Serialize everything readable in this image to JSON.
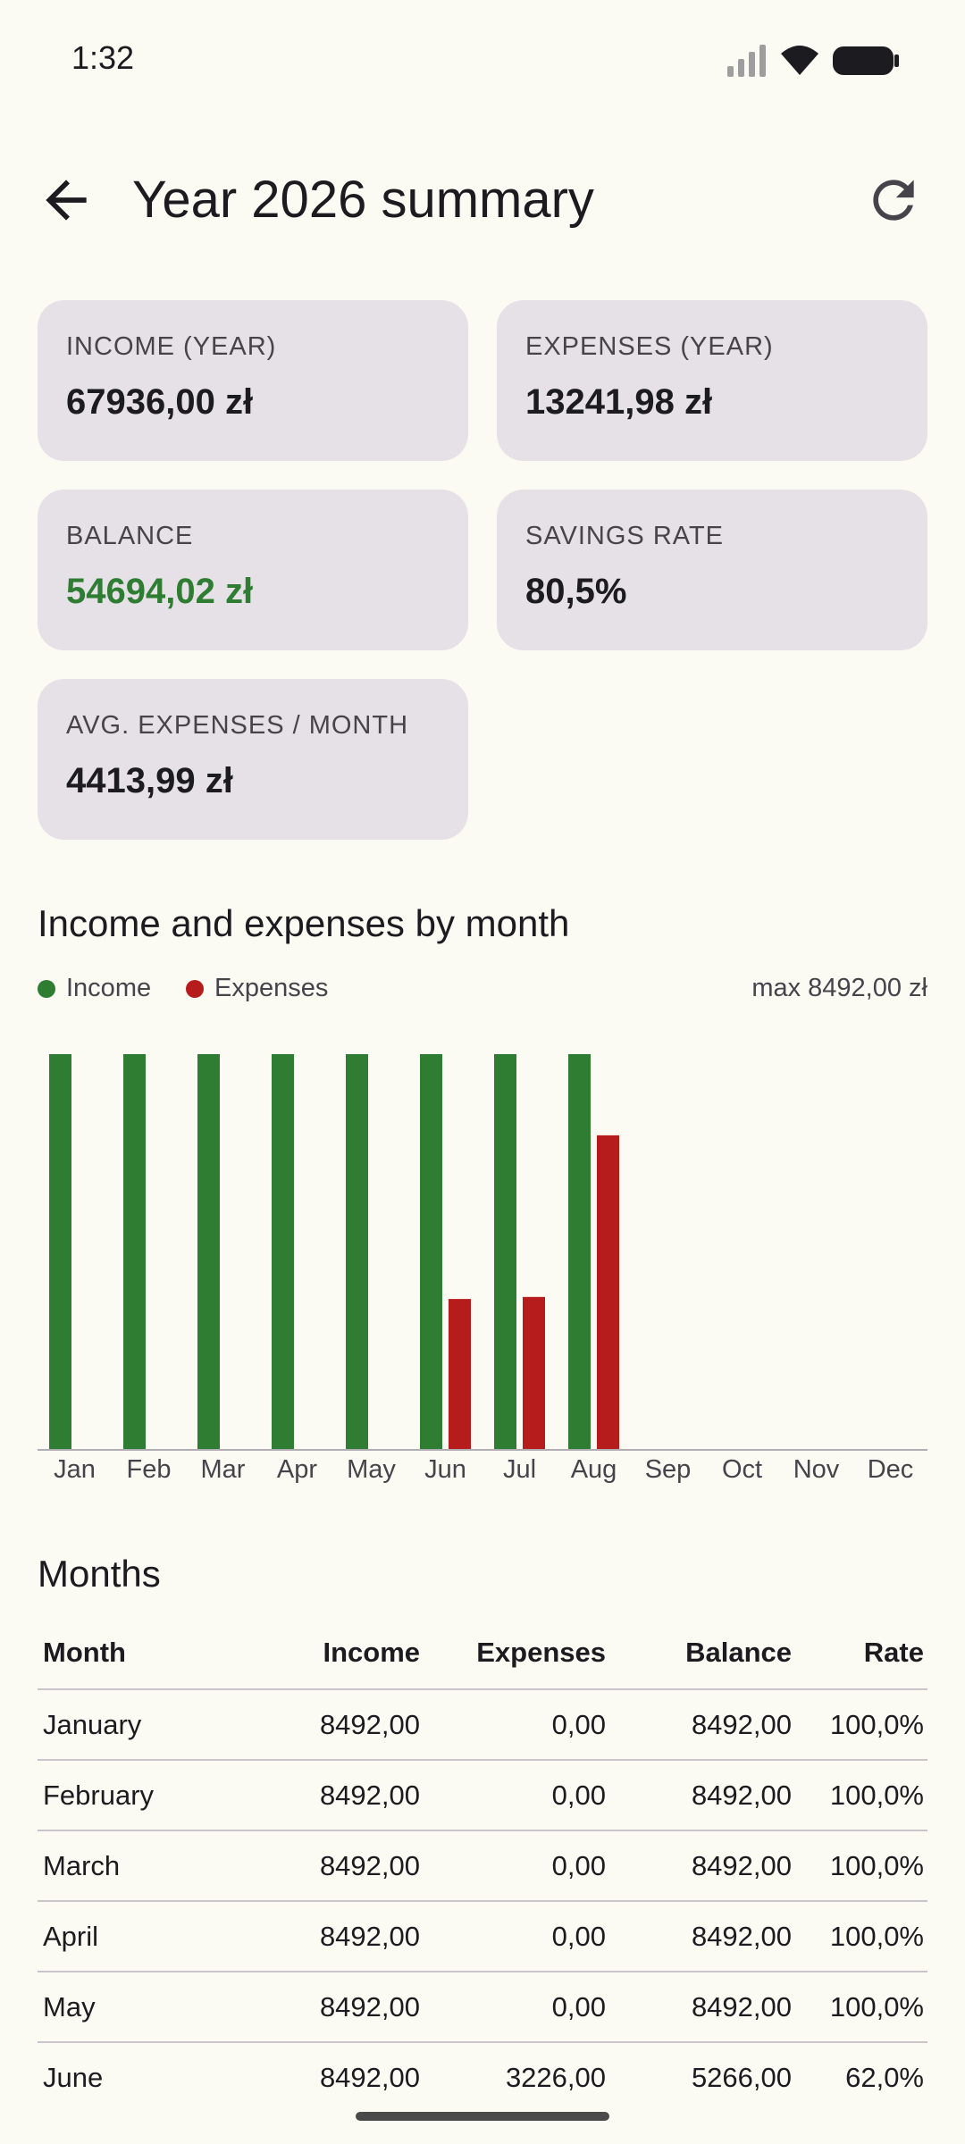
{
  "status_bar": {
    "time": "1:32",
    "icons": [
      "signal-icon",
      "wifi-icon",
      "battery-icon"
    ]
  },
  "app_bar": {
    "title": "Year 2026 summary",
    "back_icon": "arrow-back-icon",
    "refresh_icon": "refresh-icon"
  },
  "cards": {
    "income": {
      "label": "INCOME (YEAR)",
      "value": "67936,00 zł"
    },
    "expenses": {
      "label": "EXPENSES (YEAR)",
      "value": "13241,98 zł"
    },
    "balance": {
      "label": "BALANCE",
      "value": "54694,02 zł"
    },
    "savings": {
      "label": "SAVINGS RATE",
      "value": "80,5%"
    },
    "avg": {
      "label": "AVG. EXPENSES / MONTH",
      "value": "4413,99 zł"
    }
  },
  "chart_section": {
    "title": "Income and expenses by month",
    "legend_income": "Income",
    "legend_expenses": "Expenses",
    "max_label": "max 8492,00 zł"
  },
  "chart_data": {
    "type": "bar",
    "categories": [
      "Jan",
      "Feb",
      "Mar",
      "Apr",
      "May",
      "Jun",
      "Jul",
      "Aug",
      "Sep",
      "Oct",
      "Nov",
      "Dec"
    ],
    "series": [
      {
        "name": "Income",
        "color": "#2E7D32",
        "values": [
          8492,
          8492,
          8492,
          8492,
          8492,
          8492,
          8492,
          8492,
          0,
          0,
          0,
          0
        ]
      },
      {
        "name": "Expenses",
        "color": "#B71C1C",
        "values": [
          0,
          0,
          0,
          0,
          0,
          3226,
          3270,
          6745.98,
          0,
          0,
          0,
          0
        ]
      }
    ],
    "ylim": [
      0,
      8492
    ],
    "grid": false,
    "legend_position": "top-left"
  },
  "table": {
    "title": "Months",
    "headers": [
      "Month",
      "Income",
      "Expenses",
      "Balance",
      "Rate"
    ],
    "rows": [
      [
        "January",
        "8492,00",
        "0,00",
        "8492,00",
        "100,0%"
      ],
      [
        "February",
        "8492,00",
        "0,00",
        "8492,00",
        "100,0%"
      ],
      [
        "March",
        "8492,00",
        "0,00",
        "8492,00",
        "100,0%"
      ],
      [
        "April",
        "8492,00",
        "0,00",
        "8492,00",
        "100,0%"
      ],
      [
        "May",
        "8492,00",
        "0,00",
        "8492,00",
        "100,0%"
      ],
      [
        "June",
        "8492,00",
        "3226,00",
        "5266,00",
        "62,0%"
      ]
    ]
  }
}
